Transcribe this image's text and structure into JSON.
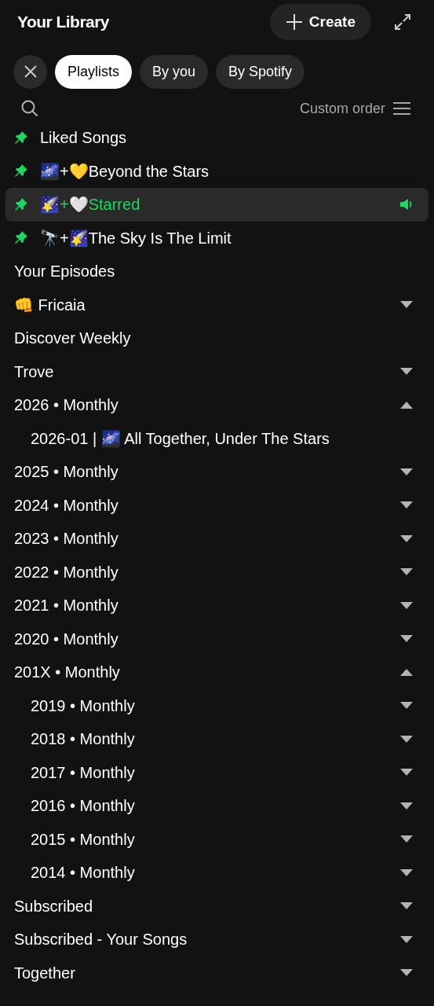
{
  "header": {
    "title": "Your Library",
    "create_label": "Create"
  },
  "filters": [
    {
      "label": "Playlists",
      "selected": true
    },
    {
      "label": "By you",
      "selected": false
    },
    {
      "label": "By Spotify",
      "selected": false
    }
  ],
  "sort": {
    "label": "Custom order"
  },
  "items": [
    {
      "kind": "playlist",
      "title": "Liked Songs",
      "pinned": true,
      "playing": false
    },
    {
      "kind": "playlist",
      "title": "🌌+💛Beyond the Stars",
      "pinned": true,
      "playing": false
    },
    {
      "kind": "playlist",
      "title": "🌠+🤍Starred",
      "pinned": true,
      "playing": true
    },
    {
      "kind": "playlist",
      "title": "🔭+🌠The Sky Is The Limit",
      "pinned": true,
      "playing": false
    },
    {
      "kind": "playlist",
      "title": "Your Episodes",
      "pinned": false,
      "playing": false
    },
    {
      "kind": "folder",
      "title": "👊 Fricaia",
      "pinned": false,
      "playing": false,
      "expanded": false
    },
    {
      "kind": "playlist",
      "title": "Discover Weekly",
      "pinned": false,
      "playing": false
    },
    {
      "kind": "folder",
      "title": "Trove",
      "pinned": false,
      "playing": false,
      "expanded": false
    },
    {
      "kind": "folder",
      "title": "2026 • Monthly",
      "pinned": false,
      "playing": false,
      "expanded": true,
      "children": [
        {
          "kind": "playlist",
          "title": "2026-01 | 🌌 All Together, Under The Stars",
          "pinned": false,
          "playing": false
        }
      ]
    },
    {
      "kind": "folder",
      "title": "2025 • Monthly",
      "pinned": false,
      "playing": false,
      "expanded": false
    },
    {
      "kind": "folder",
      "title": "2024 • Monthly",
      "pinned": false,
      "playing": false,
      "expanded": false
    },
    {
      "kind": "folder",
      "title": "2023 • Monthly",
      "pinned": false,
      "playing": false,
      "expanded": false
    },
    {
      "kind": "folder",
      "title": "2022 • Monthly",
      "pinned": false,
      "playing": false,
      "expanded": false
    },
    {
      "kind": "folder",
      "title": "2021 • Monthly",
      "pinned": false,
      "playing": false,
      "expanded": false
    },
    {
      "kind": "folder",
      "title": "2020 • Monthly",
      "pinned": false,
      "playing": false,
      "expanded": false
    },
    {
      "kind": "folder",
      "title": "201X • Monthly",
      "pinned": false,
      "playing": false,
      "expanded": true,
      "children": [
        {
          "kind": "folder",
          "title": "2019 • Monthly",
          "pinned": false,
          "playing": false,
          "expanded": false
        },
        {
          "kind": "folder",
          "title": "2018 • Monthly",
          "pinned": false,
          "playing": false,
          "expanded": false
        },
        {
          "kind": "folder",
          "title": "2017 • Monthly",
          "pinned": false,
          "playing": false,
          "expanded": false
        },
        {
          "kind": "folder",
          "title": "2016 • Monthly",
          "pinned": false,
          "playing": false,
          "expanded": false
        },
        {
          "kind": "folder",
          "title": "2015 • Monthly",
          "pinned": false,
          "playing": false,
          "expanded": false
        },
        {
          "kind": "folder",
          "title": "2014 • Monthly",
          "pinned": false,
          "playing": false,
          "expanded": false
        }
      ]
    },
    {
      "kind": "folder",
      "title": "Subscribed",
      "pinned": false,
      "playing": false,
      "expanded": false
    },
    {
      "kind": "folder",
      "title": "Subscribed - Your Songs",
      "pinned": false,
      "playing": false,
      "expanded": false
    },
    {
      "kind": "folder",
      "title": "Together",
      "pinned": false,
      "playing": false,
      "expanded": false
    }
  ]
}
